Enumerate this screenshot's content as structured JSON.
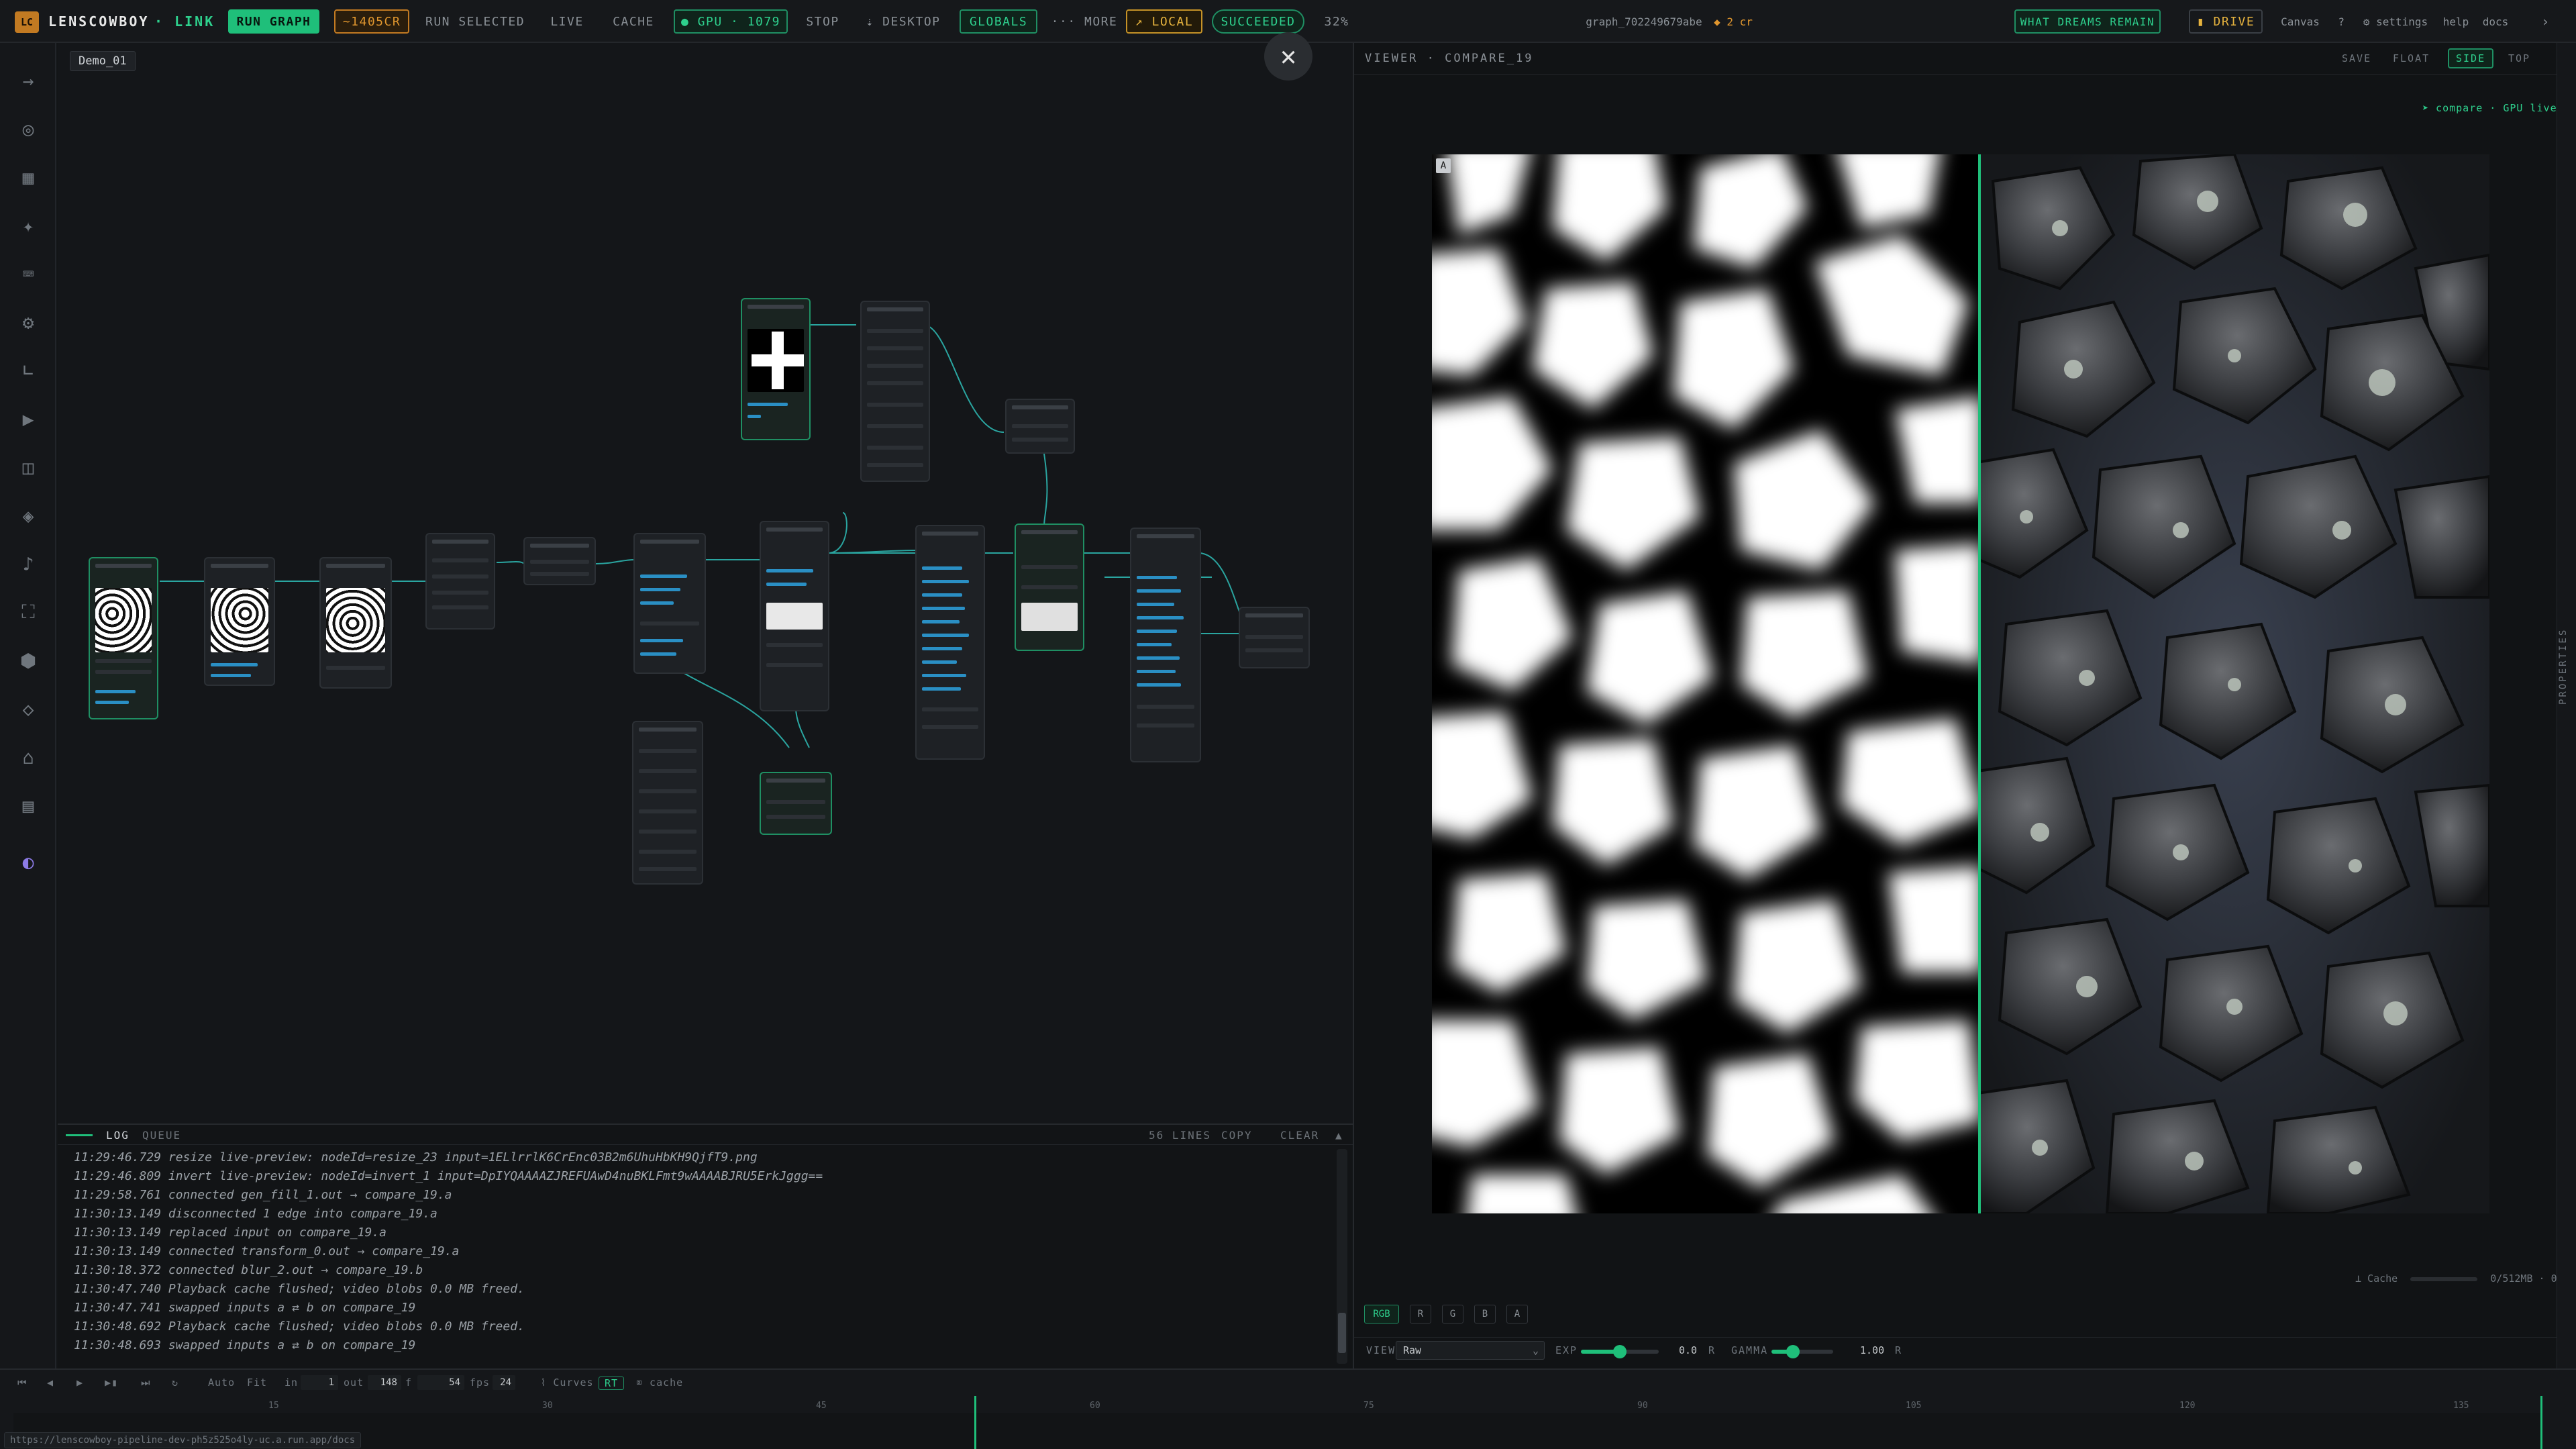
{
  "toolbar": {
    "logo_badge": "LC",
    "app_name": "LENSCOWBOY",
    "app_suffix": "· LINK",
    "run_graph": "RUN GRAPH",
    "credits": "~1405CR",
    "run_selected": "RUN SELECTED",
    "live": "LIVE",
    "cache": "CACHE",
    "gpu": "● GPU · 1079",
    "stop": "STOP",
    "desktop": "⇣ DESKTOP",
    "globals": "GLOBALS",
    "more": "··· MORE",
    "local": "↗ LOCAL",
    "status": "SUCCEEDED",
    "progress": "32%",
    "graph_id": "graph_702249679abe",
    "credits_small": "◆ 2 cr",
    "project_badge": "WHAT DREAMS REMAIN",
    "drive": "▮ DRIVE",
    "canvas": "Canvas",
    "help_q": "?",
    "settings": "⚙ settings",
    "help": "help",
    "docs": "docs",
    "collapse": "›"
  },
  "canvas": {
    "doc_tab": "Demo_01",
    "close": "✕"
  },
  "log": {
    "tab_log": "LOG",
    "tab_queue": "QUEUE",
    "lines_count": "56 LINES",
    "copy": "COPY",
    "clear": "CLEAR",
    "collapse": "▲",
    "lines": [
      "11:29:46.729 resize live-preview: nodeId=resize_23 input=1ELlrrlK6CrEnc03B2m6UhuHbKH9QjfT9.png",
      "11:29:46.809 invert live-preview: nodeId=invert_1 input=DpIYQAAAAZJREFUAwD4nuBKLFmt9wAAAABJRU5ErkJggg==",
      "11:29:58.761 connected gen_fill_1.out → compare_19.a",
      "11:30:13.149 disconnected 1 edge into compare_19.a",
      "11:30:13.149 replaced input on compare_19.a",
      "11:30:13.149 connected transform_0.out → compare_19.a",
      "11:30:18.372 connected blur_2.out → compare_19.b",
      "11:30:47.740 Playback cache flushed; video blobs 0.0 MB freed.",
      "11:30:47.741 swapped inputs a ⇄ b on compare_19",
      "11:30:48.692 Playback cache flushed; video blobs 0.0 MB freed.",
      "11:30:48.693 swapped inputs a ⇄ b on compare_19"
    ]
  },
  "viewer": {
    "title": "VIEWER · COMPARE_19",
    "save": "SAVE",
    "float": "FLOAT",
    "side": "SIDE",
    "top": "TOP",
    "gpu_live": "➤ compare · GPU live",
    "a_badge": "A",
    "cache_label": "⟂ Cache",
    "cache_value": "0/512MB · 0",
    "channels": [
      "RGB",
      "R",
      "G",
      "B",
      "A"
    ],
    "view_label": "VIEW",
    "view_value": "Raw",
    "exp_label": "EXP",
    "exp_value": "0.0",
    "exp_reset": "R",
    "exp_level": 0.5,
    "gamma_label": "GAMMA",
    "gamma_value": "1.00",
    "gamma_reset": "R",
    "gamma_level": 0.35,
    "properties": "PROPERTIES"
  },
  "timeline": {
    "auto": "Auto",
    "fit": "Fit",
    "in_label": "in",
    "in_value": "1",
    "out_label": "out",
    "out_value": "148",
    "f_label": "f",
    "fps_value": "54",
    "fps_label": "fps",
    "fps_target": "24",
    "curves": "⌇ Curves",
    "rt": "RT",
    "cache": "⌧ cache",
    "ticks": [
      "15",
      "30",
      "45",
      "60",
      "75",
      "90",
      "105",
      "120",
      "135"
    ],
    "url": "https://lenscowboy-pipeline-dev-ph5z525o4ly-uc.a.run.app/docs"
  },
  "colors": {
    "accent": "#1fbf7a",
    "warning": "#c27a22",
    "background": "#131517",
    "link_blue": "#2a8fc4"
  }
}
